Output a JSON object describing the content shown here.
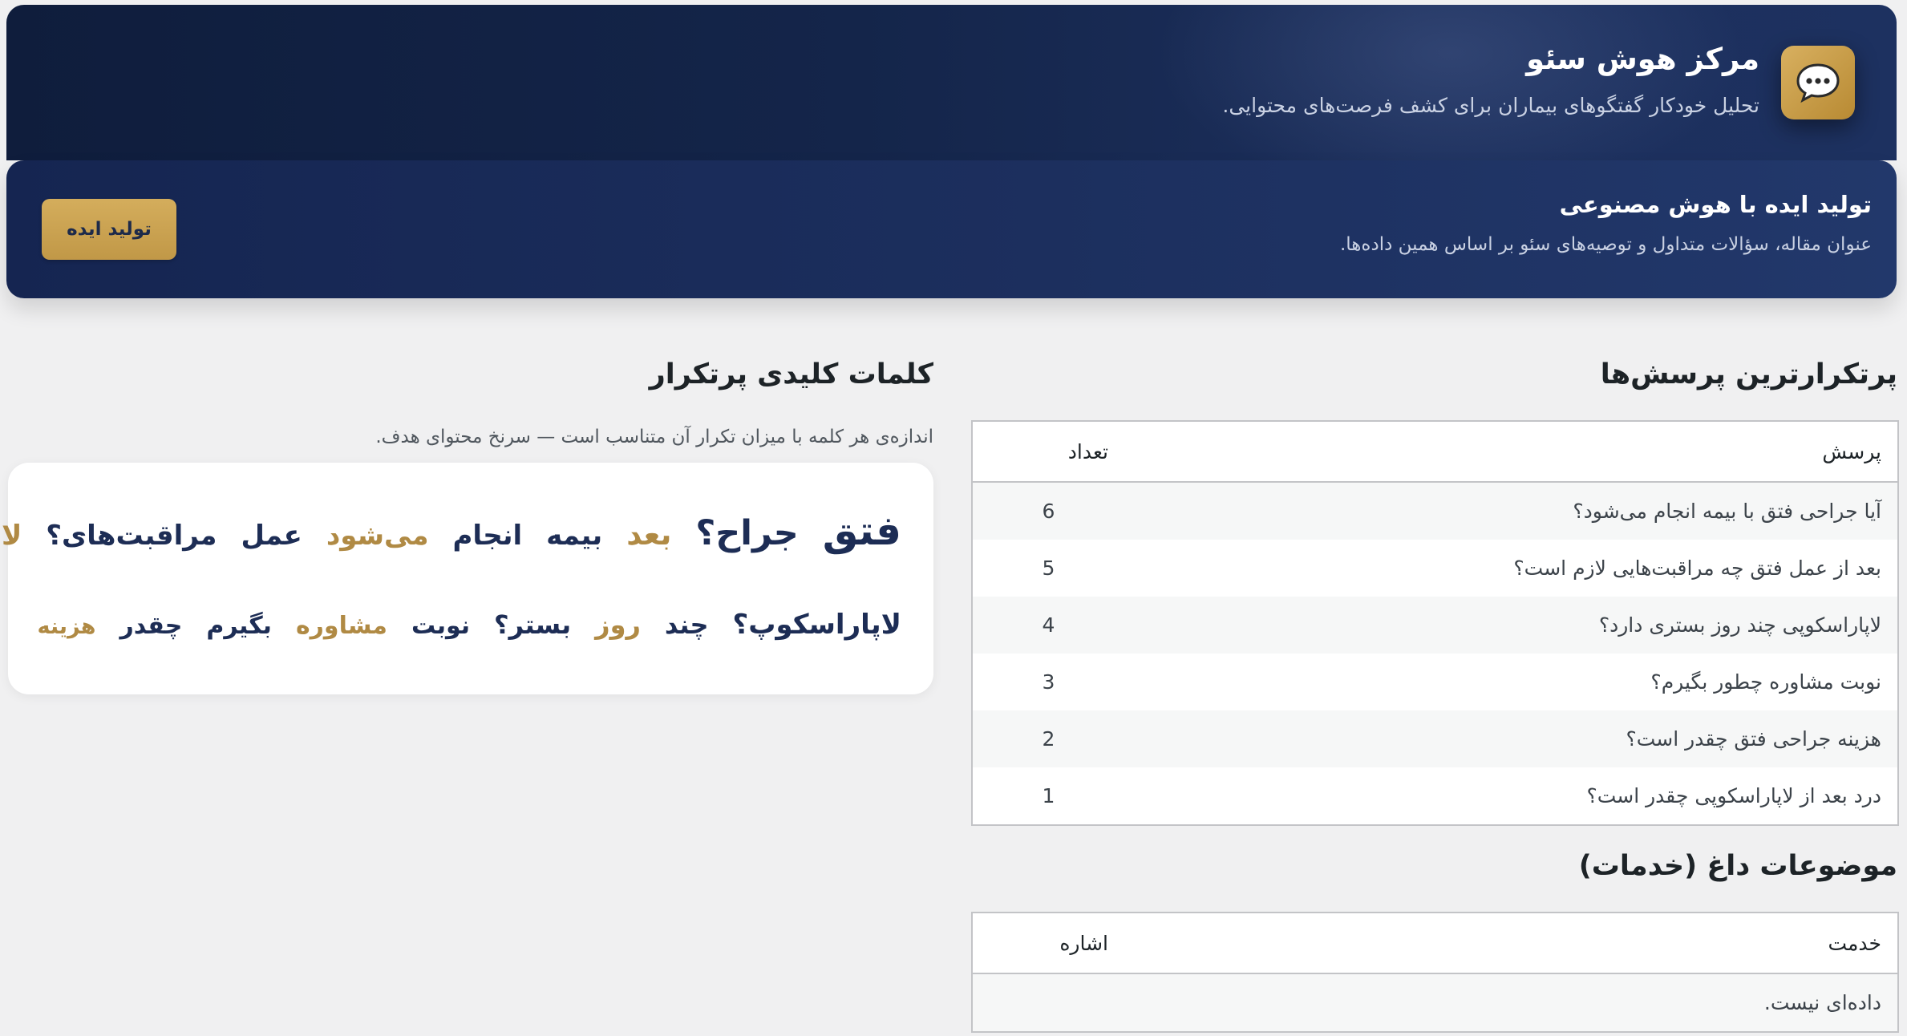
{
  "header": {
    "title": "مرکز هوش سئو",
    "subtitle": "تحلیل خودکار گفتگوهای بیماران برای کشف فرصت‌های محتوایی.",
    "icon": "chat-bubble-icon",
    "icon_color": "#c9a14f"
  },
  "ai_banner": {
    "title": "تولید ایده با هوش مصنوعی",
    "description": "عنوان مقاله، سؤالات متداول و توصیه‌های سئو بر اساس همین داده‌ها.",
    "button_label": "تولید ایده"
  },
  "questions": {
    "heading": "پرتکرارترین پرسش‌ها",
    "columns": [
      "پرسش",
      "تعداد"
    ],
    "rows": [
      {
        "question": "آیا جراحی فتق با بیمه انجام می‌شود؟",
        "count": "6"
      },
      {
        "question": "بعد از عمل فتق چه مراقبت‌هایی لازم است؟",
        "count": "5"
      },
      {
        "question": "لاپاراسکوپی چند روز بستری دارد؟",
        "count": "4"
      },
      {
        "question": "نوبت مشاوره چطور بگیرم؟",
        "count": "3"
      },
      {
        "question": "هزینه جراحی فتق چقدر است؟",
        "count": "2"
      },
      {
        "question": "درد بعد از لاپاراسکوپی چقدر است؟",
        "count": "1"
      }
    ]
  },
  "hot_topics": {
    "heading": "موضوعات داغ (خدمات)",
    "columns": [
      "خدمت",
      "اشاره"
    ],
    "empty_text": "داده‌ای نیست."
  },
  "keywords": {
    "heading": "کلمات کلیدی پرتکرار",
    "description": "اندازه‌ی هر کلمه با میزان تکرار آن متناسب است — سرنخ محتوای هدف.",
    "line1": [
      {
        "word": "فتق",
        "size": 50,
        "color": "navy"
      },
      {
        "word": "جراح؟",
        "size": 43,
        "color": "navy"
      },
      {
        "word": "بعد",
        "size": 37,
        "color": "gold"
      },
      {
        "word": "بیمه",
        "size": 34,
        "color": "navy"
      },
      {
        "word": "انجام",
        "size": 34,
        "color": "navy"
      },
      {
        "word": "می‌شود",
        "size": 34,
        "color": "gold"
      },
      {
        "word": "عمل",
        "size": 34,
        "color": "navy"
      },
      {
        "word": "مراقبت‌های؟",
        "size": 34,
        "color": "navy"
      },
      {
        "word": "لازم",
        "size": 34,
        "color": "gold"
      }
    ],
    "line2": [
      {
        "word": "لاپاراسکوپ؟",
        "size": 34,
        "color": "navy"
      },
      {
        "word": "چند",
        "size": 32,
        "color": "navy"
      },
      {
        "word": "روز",
        "size": 32,
        "color": "gold"
      },
      {
        "word": "بستر؟",
        "size": 32,
        "color": "navy"
      },
      {
        "word": "نوبت",
        "size": 30,
        "color": "navy"
      },
      {
        "word": "مشاوره",
        "size": 30,
        "color": "gold"
      },
      {
        "word": "بگیرم",
        "size": 30,
        "color": "navy"
      },
      {
        "word": "چقدر",
        "size": 30,
        "color": "navy"
      },
      {
        "word": "هزینه",
        "size": 27,
        "color": "gold"
      }
    ]
  }
}
